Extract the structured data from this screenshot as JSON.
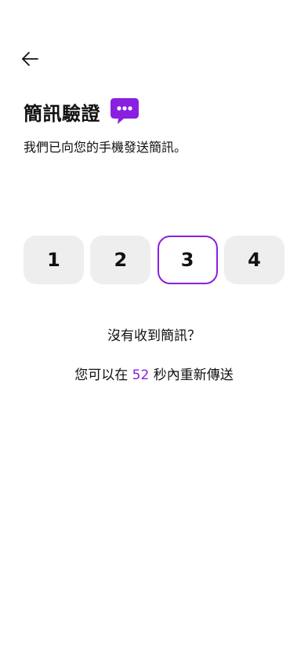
{
  "header": {
    "back_icon": "arrow-left-icon",
    "title": "簡訊驗證",
    "title_icon": "chat-bubble-dots-icon",
    "subtitle": "我們已向您的手機發送簡訊。"
  },
  "otp": {
    "digits": [
      "1",
      "2",
      "3",
      "4"
    ],
    "active_index": 2
  },
  "help": {
    "no_sms_text": "沒有收到簡訊？",
    "resend_prefix": "您可以在 ",
    "countdown": "52",
    "resend_suffix": " 秒內重新傳送"
  },
  "colors": {
    "accent": "#8a1fe0",
    "box_bg": "#eeeeee",
    "text": "#111111"
  }
}
